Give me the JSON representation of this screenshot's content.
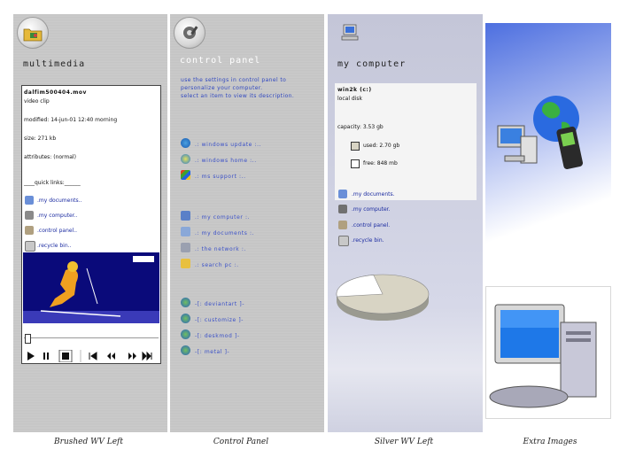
{
  "panels": {
    "multimedia": {
      "title": "multimedia",
      "file_name": "dalfim500404.mov",
      "file_type": "video clip",
      "modified": "modified: 14-jun-01 12:40 morning",
      "size": "size: 271 kb",
      "attributes": "attributes: (normal)",
      "quick_links_header": "____quick links:______",
      "links": [
        ".my documents..",
        ".my computer..",
        ".control panel..",
        ".recycle bin.."
      ],
      "player": {
        "progress": 0
      }
    },
    "control_panel": {
      "title": "control panel",
      "description": [
        "use the settings in control panel to",
        "personalize your computer.",
        "select an item to view its description."
      ],
      "group1": [
        ".: windows update :..",
        ".: windows home :..",
        ".: ms support :.."
      ],
      "group2": [
        ".: my computer :.",
        ".: my documents :.",
        ".: the network :.",
        ".: search pc :."
      ],
      "group3": [
        "-[: deviantart ]-",
        "-[: customize ]-",
        "-[: deskmod ]-",
        "-[: metal ]-"
      ]
    },
    "my_computer": {
      "title": "my computer",
      "drive_name": "win2k (c:)",
      "drive_type": "local disk",
      "capacity": "capacity: 3.53 gb",
      "used": "used: 2.70 gb",
      "free": "free: 848 mb",
      "links": [
        ".my documents.",
        ".my computer.",
        ".control panel.",
        ".recycle bin."
      ],
      "used_fraction": 0.76
    }
  },
  "captions": {
    "brushed": "Brushed WV Left",
    "control": "Control Panel",
    "silver": "Silver WV Left",
    "extra": "Extra Images"
  },
  "colors": {
    "link": "#1a2aa0",
    "cp_link": "#3a50c8",
    "cp_text": "#2f47c0"
  }
}
